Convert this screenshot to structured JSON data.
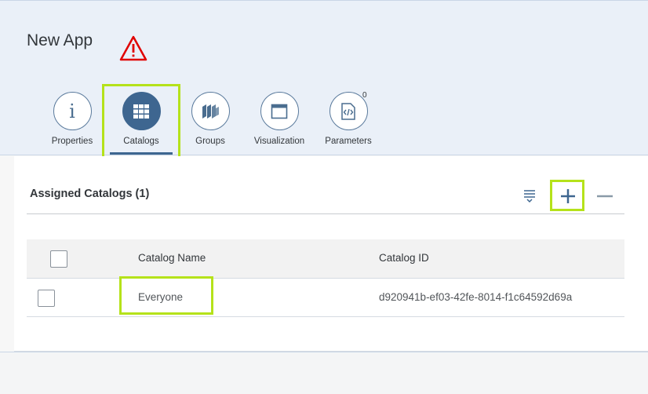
{
  "app": {
    "title": "New App"
  },
  "warning": {
    "icon": "warning-triangle-icon",
    "color": "#e00000"
  },
  "tabs": [
    {
      "id": "properties",
      "label": "Properties",
      "icon": "info-icon"
    },
    {
      "id": "catalogs",
      "label": "Catalogs",
      "icon": "grid-icon",
      "selected": true
    },
    {
      "id": "groups",
      "label": "Groups",
      "icon": "groups-icon"
    },
    {
      "id": "visualization",
      "label": "Visualization",
      "icon": "window-icon"
    },
    {
      "id": "parameters",
      "label": "Parameters",
      "icon": "code-document-icon",
      "count": "0"
    }
  ],
  "section": {
    "title": "Assigned Catalogs (1)",
    "actions": {
      "filter": "filter-icon",
      "add": "plus-icon",
      "remove": "minus-icon"
    }
  },
  "table": {
    "columns": [
      "Catalog Name",
      "Catalog ID"
    ],
    "rows": [
      {
        "name": "Everyone",
        "id": "d920941b-ef03-42fe-8014-f1c64592d69a"
      }
    ]
  },
  "colors": {
    "accent": "#3e6690",
    "highlight": "#b5e21a",
    "header_bg": "#eaf0f8"
  }
}
